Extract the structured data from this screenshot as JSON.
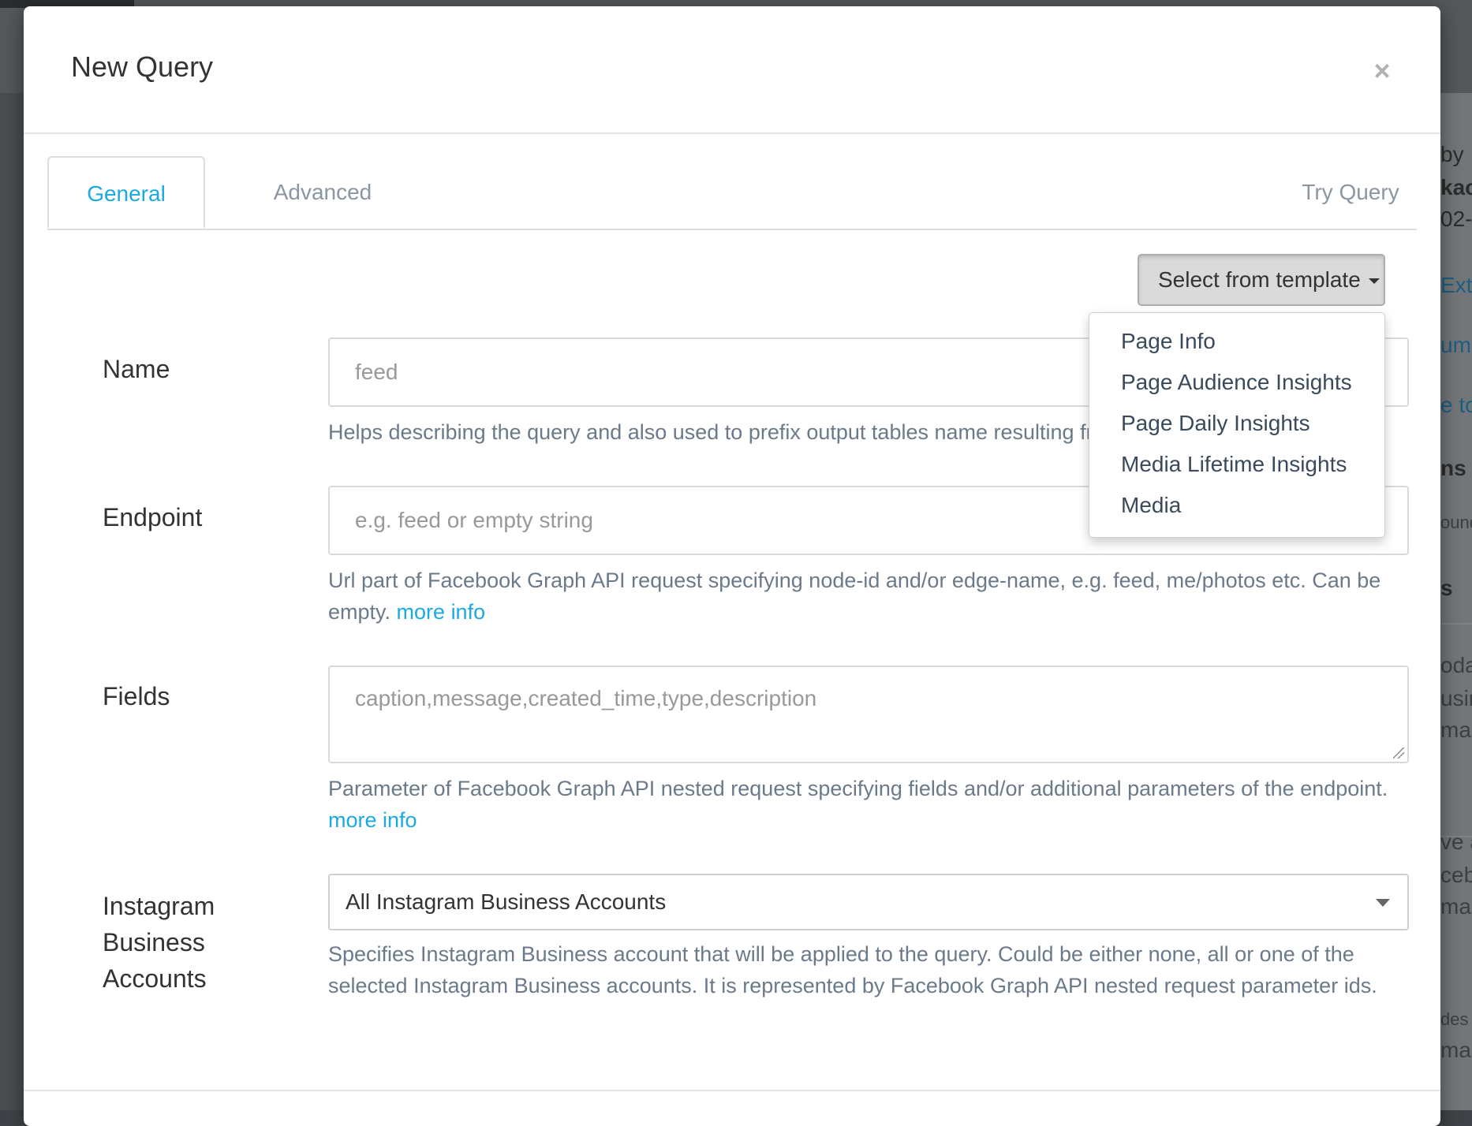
{
  "modal": {
    "title": "New Query",
    "close_symbol": "×"
  },
  "tabs": [
    {
      "label": "General",
      "active": true
    },
    {
      "label": "Advanced",
      "active": false
    },
    {
      "label": "Try Query",
      "active": false
    }
  ],
  "template_button": {
    "label": "Select from template",
    "items": [
      "Page Info",
      "Page Audience Insights",
      "Page Daily Insights",
      "Media Lifetime Insights",
      "Media"
    ]
  },
  "form": {
    "name": {
      "label": "Name",
      "placeholder": "feed",
      "help": "Helps describing the query and also used to prefix output tables name resulting from t"
    },
    "endpoint": {
      "label": "Endpoint",
      "placeholder": "e.g. feed or empty string",
      "help": "Url part of Facebook Graph API request specifying node-id and/or edge-name, e.g. feed, me/photos etc. Can be empty.",
      "link": "more info"
    },
    "fields": {
      "label": "Fields",
      "placeholder": "caption,message,created_time,type,description",
      "help": "Parameter of Facebook Graph API nested request specifying fields and/or additional parameters of the endpoint.",
      "link": "more info"
    },
    "accounts": {
      "label_lines": [
        "Instagram",
        "Business",
        "Accounts"
      ],
      "value": "All Instagram Business Accounts",
      "help": "Specifies Instagram Business account that will be applied to the query. Could be either none, all or one of the selected Instagram Business accounts. It is represented by Facebook Graph API nested request parameter ids."
    }
  },
  "background": {
    "fragments": [
      "by",
      "kac",
      "02-",
      "Ext",
      "ume",
      "e to",
      "ns",
      "ound",
      "s",
      "odat",
      "usine",
      "mas",
      "ve a",
      "ceb",
      "mas",
      "des",
      "mas"
    ]
  },
  "colors": {
    "accent": "#1ba9e1",
    "tab_inactive": "#8a96a3",
    "help_text": "#6b7a8a"
  }
}
